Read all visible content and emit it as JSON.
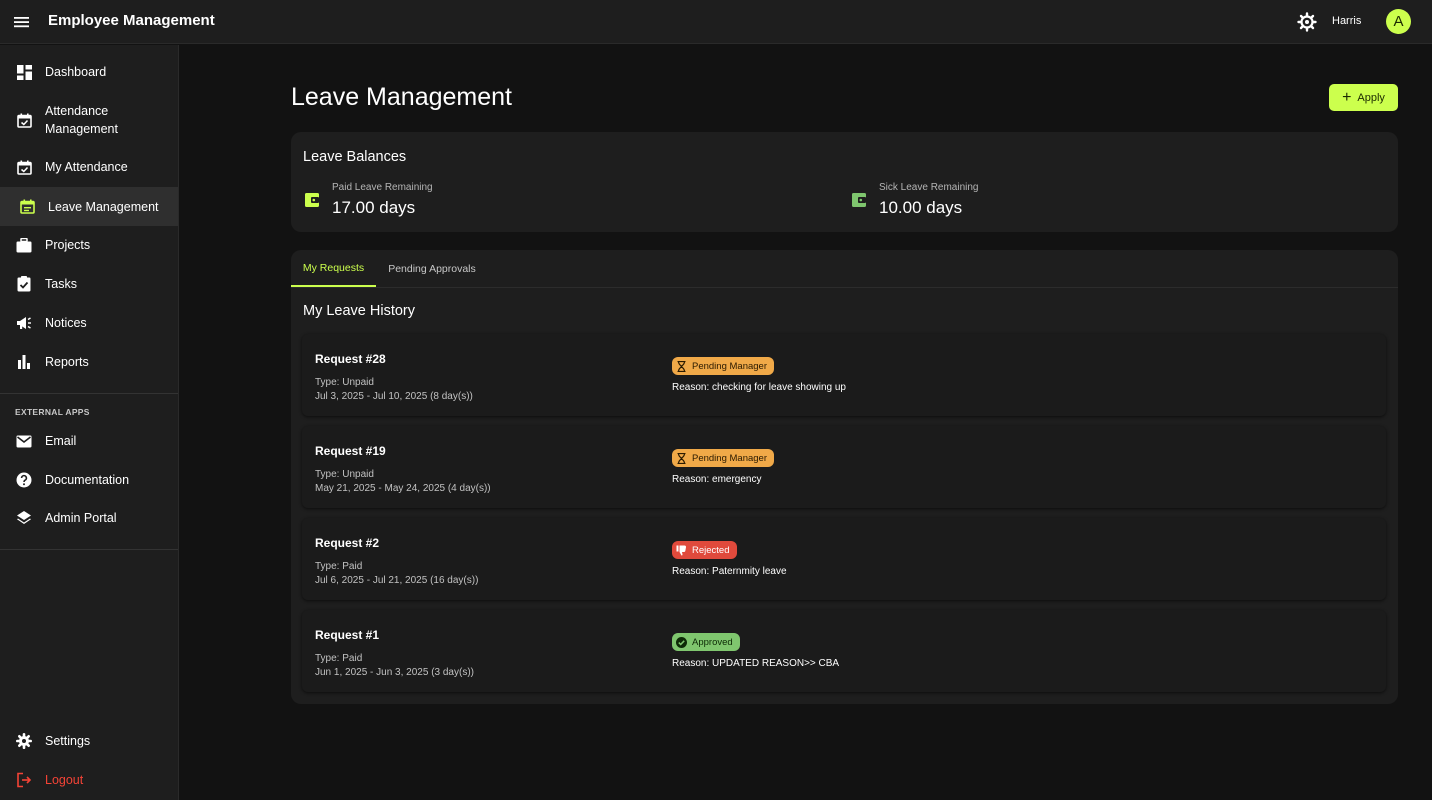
{
  "app": {
    "title": "Employee Management",
    "user_name": "Harris",
    "avatar_initial": "A",
    "accent_color": "#ccff4d"
  },
  "sidebar": {
    "items": [
      {
        "label": "Dashboard",
        "icon": "dashboard-icon"
      },
      {
        "label": "Attendance\nManagement",
        "icon": "calendar-check-icon"
      },
      {
        "label": "My Attendance",
        "icon": "calendar-check-icon"
      },
      {
        "label": "Leave Management",
        "icon": "calendar-note-icon",
        "active": true
      },
      {
        "label": "Projects",
        "icon": "briefcase-icon"
      },
      {
        "label": "Tasks",
        "icon": "clipboard-check-icon"
      },
      {
        "label": "Notices",
        "icon": "megaphone-icon"
      },
      {
        "label": "Reports",
        "icon": "bar-chart-icon"
      }
    ],
    "external_label": "EXTERNAL APPS",
    "external": [
      {
        "label": "Email",
        "icon": "mail-icon"
      },
      {
        "label": "Documentation",
        "icon": "help-icon"
      },
      {
        "label": "Admin Portal",
        "icon": "layers-icon"
      }
    ],
    "settings_label": "Settings",
    "logout_label": "Logout"
  },
  "page": {
    "title": "Leave Management",
    "apply_label": "Apply"
  },
  "balances": {
    "title": "Leave Balances",
    "paid_label": "Paid Leave Remaining",
    "paid_value": "17.00 days",
    "sick_label": "Sick Leave Remaining",
    "sick_value": "10.00 days"
  },
  "tabs": {
    "my_requests": "My Requests",
    "pending_approvals": "Pending Approvals",
    "active": "my_requests"
  },
  "history": {
    "title": "My Leave History",
    "requests": [
      {
        "title": "Request #28",
        "type": "Type: Unpaid",
        "dates": "Jul 3, 2025 - Jul 10, 2025 (8 day(s))",
        "status": "Pending Manager",
        "status_kind": "pending",
        "reason": "Reason: checking for leave showing up"
      },
      {
        "title": "Request #19",
        "type": "Type: Unpaid",
        "dates": "May 21, 2025 - May 24, 2025 (4 day(s))",
        "status": "Pending Manager",
        "status_kind": "pending",
        "reason": "Reason: emergency"
      },
      {
        "title": "Request #2",
        "type": "Type: Paid",
        "dates": "Jul 6, 2025 - Jul 21, 2025 (16 day(s))",
        "status": "Rejected",
        "status_kind": "rejected",
        "reason": "Reason: Paternmity leave"
      },
      {
        "title": "Request #1",
        "type": "Type: Paid",
        "dates": "Jun 1, 2025 - Jun 3, 2025 (3 day(s))",
        "status": "Approved",
        "status_kind": "approved",
        "reason": "Reason: UPDATED REASON>> CBA"
      }
    ]
  }
}
